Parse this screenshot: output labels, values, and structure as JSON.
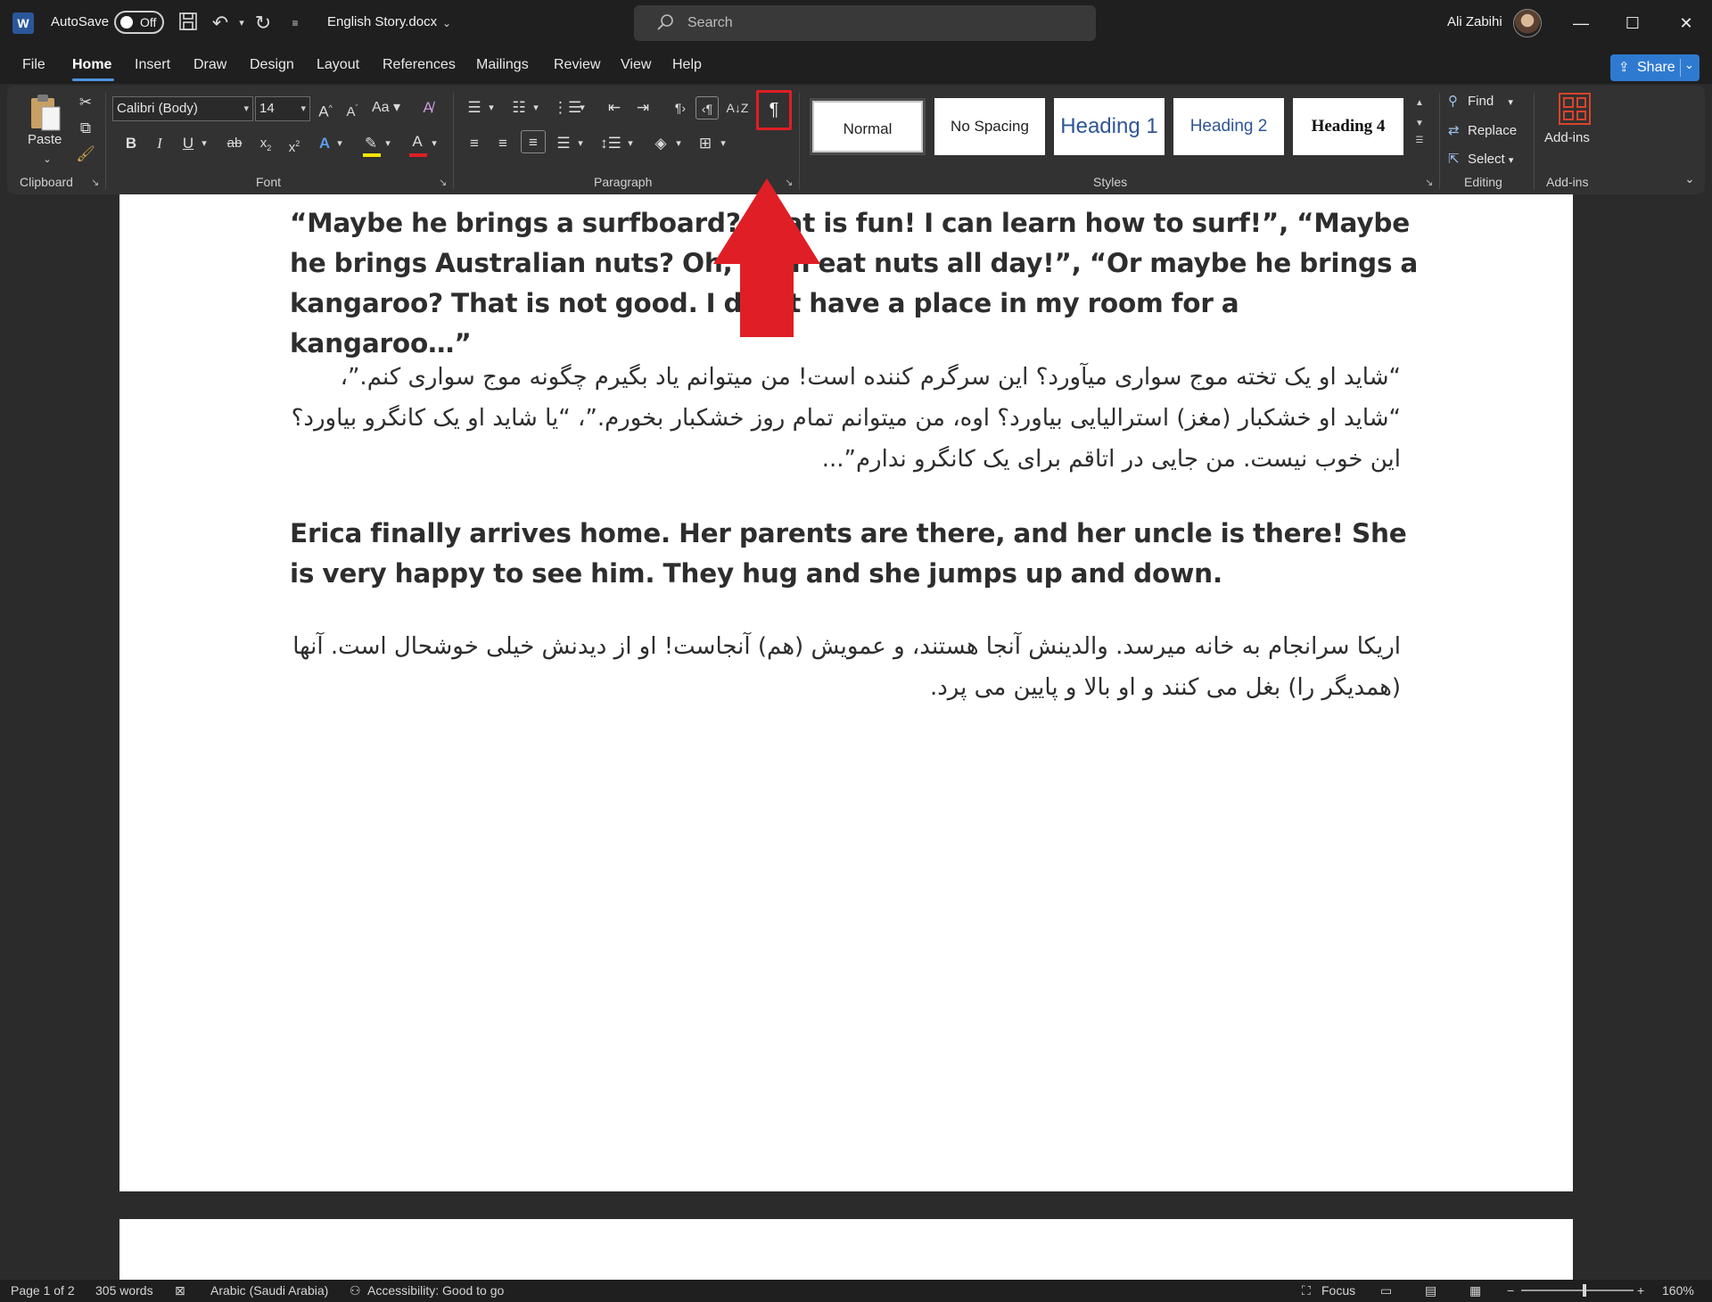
{
  "titlebar": {
    "autosave_label": "AutoSave",
    "autosave_state": "Off",
    "document_name": "English Story.docx",
    "search_placeholder": "Search",
    "user_name": "Ali Zabihi"
  },
  "menu": {
    "tabs": [
      "File",
      "Home",
      "Insert",
      "Draw",
      "Design",
      "Layout",
      "References",
      "Mailings",
      "Review",
      "View",
      "Help"
    ],
    "active_tab": "Home",
    "share_label": "Share"
  },
  "ribbon": {
    "clipboard": {
      "paste_label": "Paste",
      "group_label": "Clipboard"
    },
    "font": {
      "font_name": "Calibri (Body)",
      "font_size": "14",
      "change_case_label": "Aa",
      "group_label": "Font"
    },
    "paragraph": {
      "group_label": "Paragraph",
      "pilcrow": "¶"
    },
    "styles": {
      "group_label": "Styles",
      "items": [
        "Normal",
        "No Spacing",
        "Heading 1",
        "Heading 2",
        "Heading 4"
      ],
      "selected": "Normal"
    },
    "editing": {
      "find": "Find",
      "replace": "Replace",
      "select": "Select",
      "group_label": "Editing"
    },
    "addins": {
      "button_label": "Add-ins",
      "group_label": "Add-ins"
    }
  },
  "document": {
    "para1_en": "“Maybe he brings a surfboard? That is fun! I can learn how to surf!”, “Maybe he brings Australian nuts? Oh, I can eat nuts all day!”, “Or maybe he brings a kangaroo? That is not good. I don’t have a place in my room for a kangaroo…”",
    "para1_fa": "“شاید او یک تخته موج سواری میآورد؟ این سرگرم کننده است! من میتوانم یاد بگیرم چگونه موج سواری کنم.”، “شاید او خشکبار (مغز) استرالیایی بیاورد؟ اوه، من میتوانم تمام روز خشکبار بخورم.”، “یا شاید او یک کانگرو بیاورد؟ این خوب نیست. من جایی در اتاقم برای یک کانگرو ندارم”...",
    "para2_en": "Erica finally arrives home. Her parents are there, and her uncle is there! She is very happy to see him. They hug and she jumps up and down.",
    "para2_fa": "اریکا سرانجام به خانه میرسد. والدینش آنجا هستند، و عمویش (هم) آنجاست! او از دیدنش خیلی خوشحال است. آنها (همدیگر را) بغل می کنند و او بالا و پایین می پرد."
  },
  "statusbar": {
    "page": "Page 1 of 2",
    "words": "305 words",
    "language": "Arabic (Saudi Arabia)",
    "accessibility": "Accessibility: Good to go",
    "focus": "Focus",
    "zoom": "160%"
  },
  "colors": {
    "annotation_red": "#e01e25",
    "accent_blue": "#2f7ad1",
    "ribbon_bg": "#323232",
    "titlebar_bg": "#1f1f1f"
  }
}
